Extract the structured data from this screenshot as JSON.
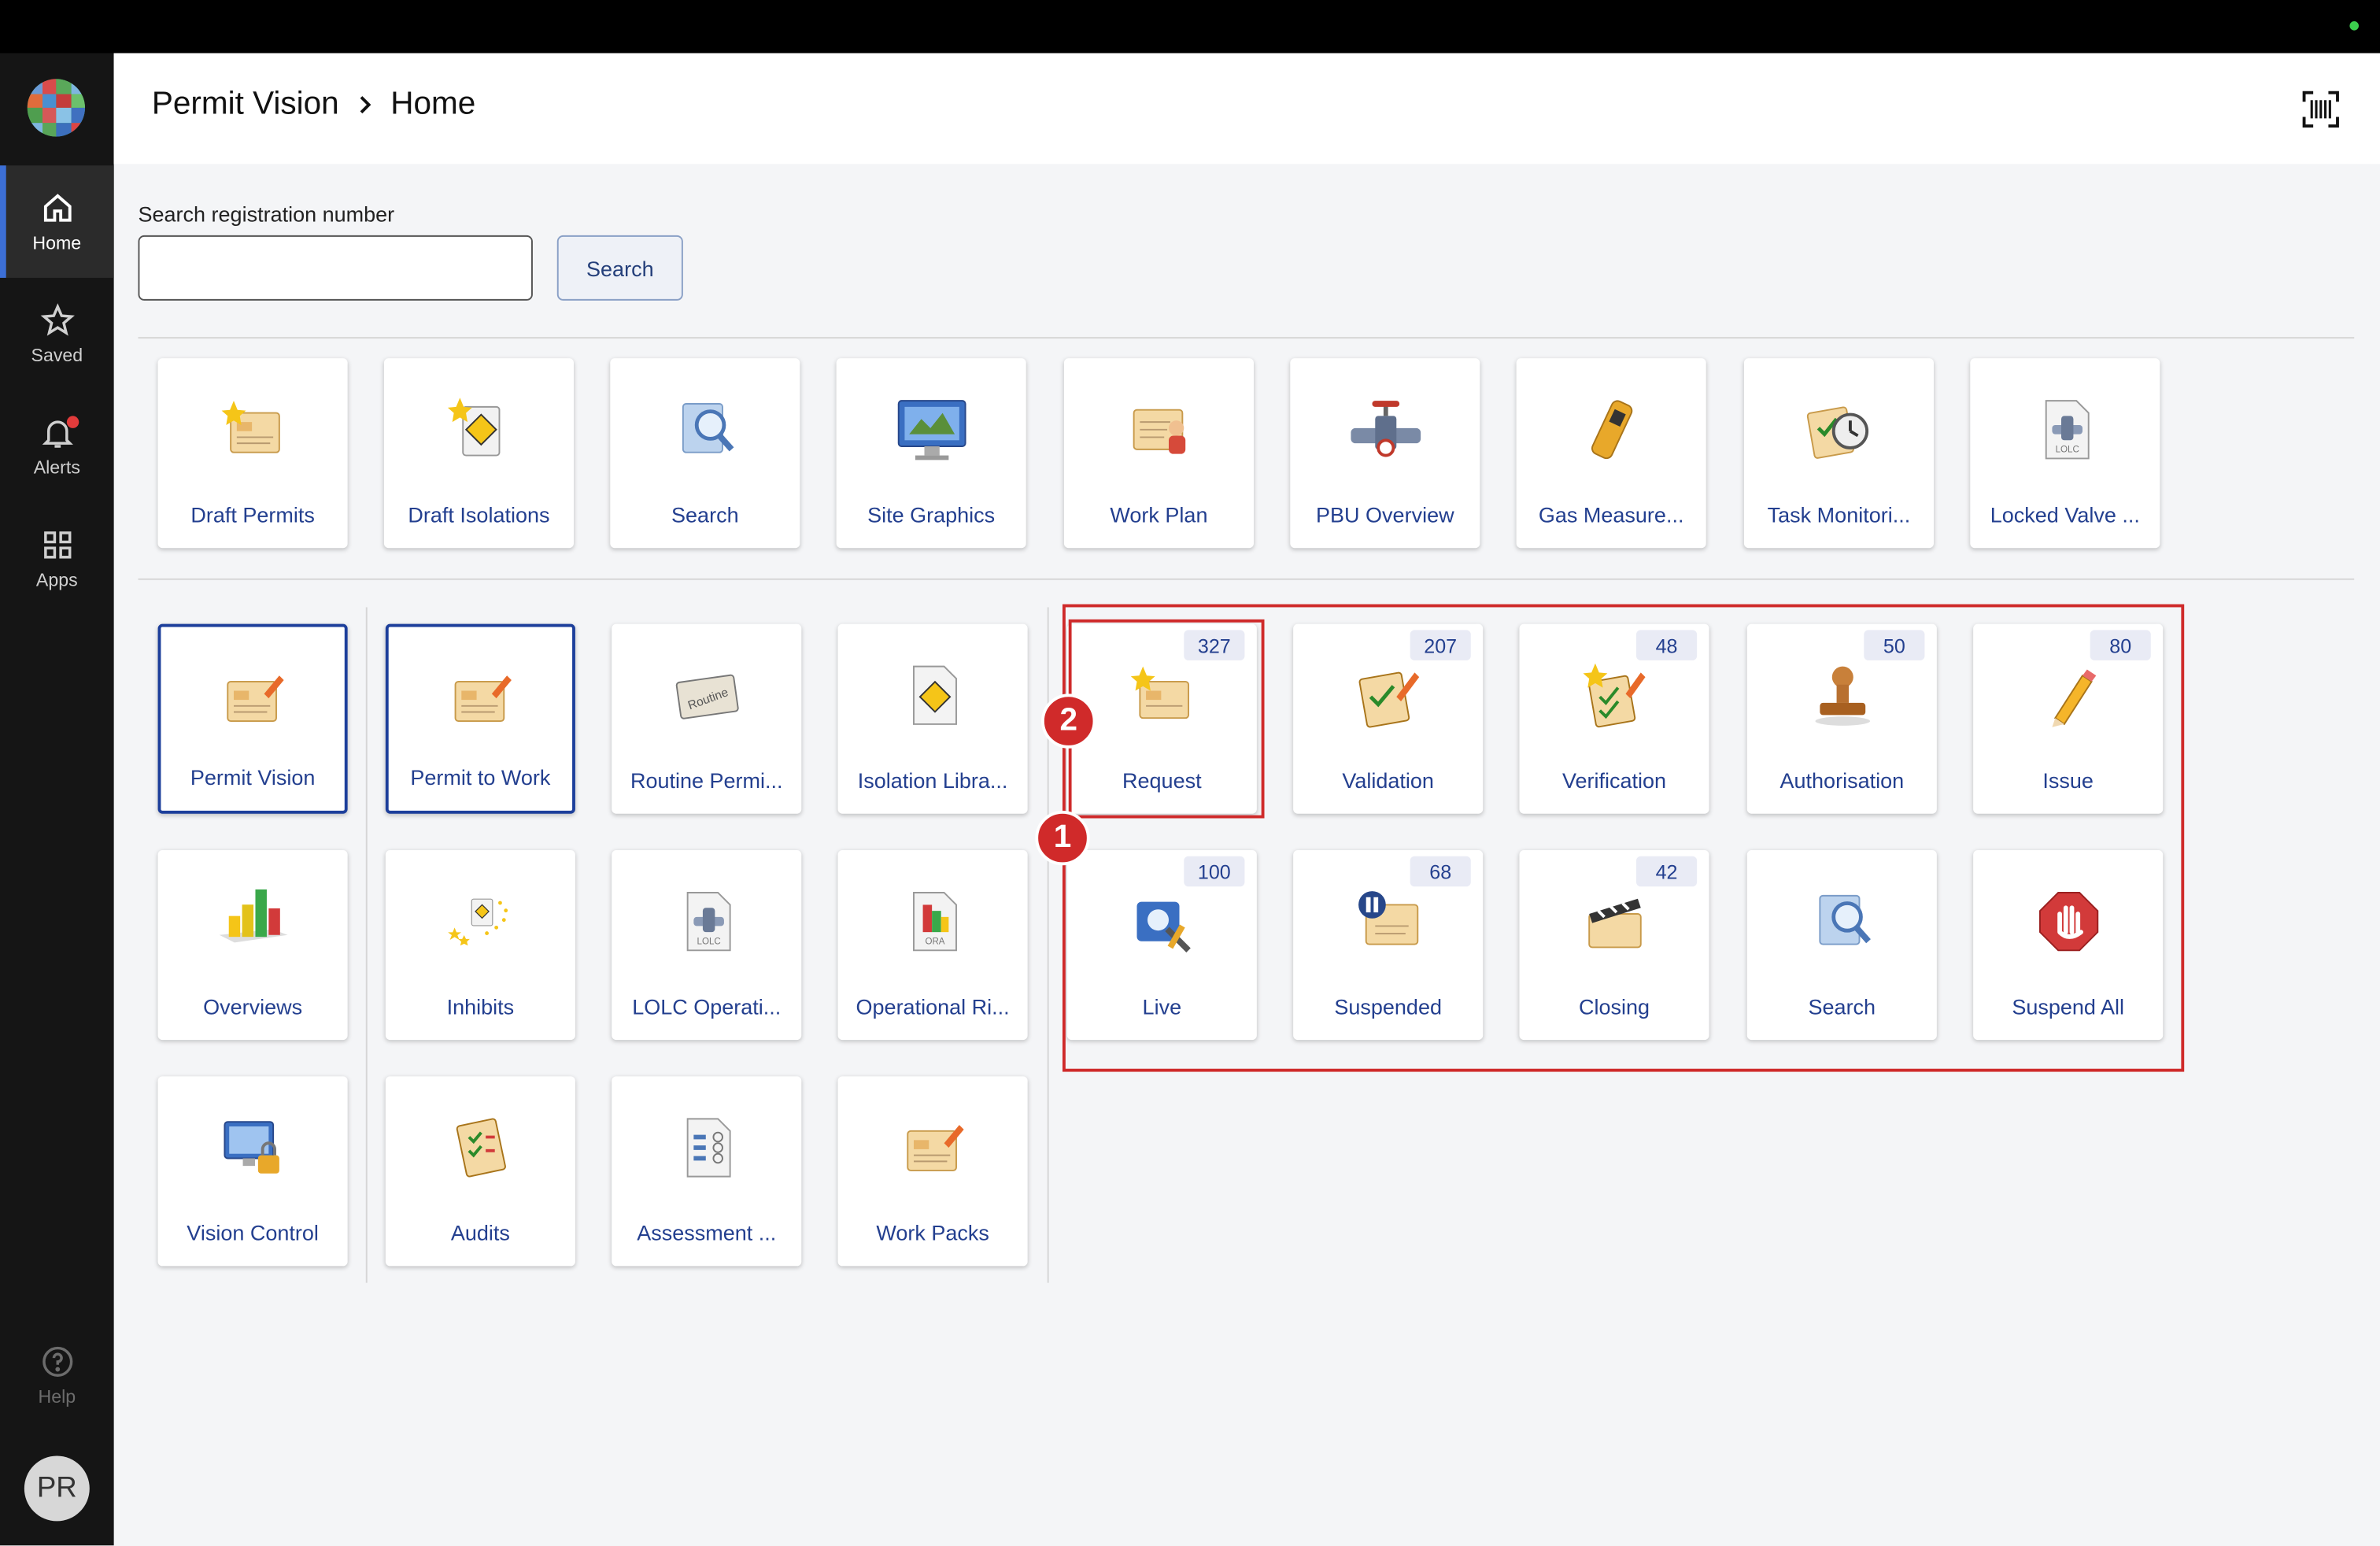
{
  "nav": {
    "home": "Home",
    "saved": "Saved",
    "alerts": "Alerts",
    "apps": "Apps",
    "help": "Help",
    "avatar_initials": "PR"
  },
  "header": {
    "breadcrumb": [
      "Permit Vision",
      "Home"
    ]
  },
  "search": {
    "label": "Search registration number",
    "value": "",
    "button": "Search"
  },
  "top_tiles": [
    {
      "label": "Draft Permits",
      "icon": "draft-permit-icon"
    },
    {
      "label": "Draft Isolations",
      "icon": "draft-isolation-icon"
    },
    {
      "label": "Search",
      "icon": "magnifier-icon"
    },
    {
      "label": "Site Graphics",
      "icon": "monitor-graphics-icon"
    },
    {
      "label": "Work Plan",
      "icon": "work-plan-icon"
    },
    {
      "label": "PBU Overview",
      "icon": "pipe-valve-icon"
    },
    {
      "label": "Gas Measure...",
      "icon": "gas-meter-icon"
    },
    {
      "label": "Task Monitori...",
      "icon": "task-stopwatch-icon"
    },
    {
      "label": "Locked Valve ...",
      "icon": "locked-valve-icon"
    }
  ],
  "left_tiles": [
    {
      "label": "Permit Vision",
      "icon": "permit-icon",
      "selected": true
    },
    {
      "label": "Permit to Work",
      "icon": "permit-icon",
      "selected": true
    },
    {
      "label": "Routine Permi...",
      "icon": "routine-icon",
      "selected": false
    },
    {
      "label": "Isolation Libra...",
      "icon": "isolation-library-icon",
      "selected": false
    },
    {
      "label": "Overviews",
      "icon": "bar-chart-icon",
      "selected": false
    },
    {
      "label": "Inhibits",
      "icon": "inhibit-stars-icon",
      "selected": false
    },
    {
      "label": "LOLC Operati...",
      "icon": "lolc-icon",
      "selected": false
    },
    {
      "label": "Operational Ri...",
      "icon": "ora-icon",
      "selected": false
    },
    {
      "label": "Vision Control",
      "icon": "monitor-lock-icon",
      "selected": false
    },
    {
      "label": "Audits",
      "icon": "audit-checklist-icon",
      "selected": false
    },
    {
      "label": "Assessment ...",
      "icon": "assessment-icon",
      "selected": false
    },
    {
      "label": "Work Packs",
      "icon": "work-pack-icon",
      "selected": false
    }
  ],
  "status_tiles": [
    {
      "label": "Request",
      "count": "327",
      "icon": "request-icon"
    },
    {
      "label": "Validation",
      "count": "207",
      "icon": "validation-icon"
    },
    {
      "label": "Verification",
      "count": "48",
      "icon": "verification-icon"
    },
    {
      "label": "Authorisation",
      "count": "50",
      "icon": "stamp-icon"
    },
    {
      "label": "Issue",
      "count": "80",
      "icon": "pencil-icon"
    },
    {
      "label": "Live",
      "count": "100",
      "icon": "live-tools-icon"
    },
    {
      "label": "Suspended",
      "count": "68",
      "icon": "pause-icon"
    },
    {
      "label": "Closing",
      "count": "42",
      "icon": "clapper-icon"
    },
    {
      "label": "Search",
      "count": "",
      "icon": "magnifier-icon"
    },
    {
      "label": "Suspend All",
      "count": "",
      "icon": "stop-hand-icon"
    }
  ],
  "annotations": {
    "marker_1": "1",
    "marker_2": "2"
  },
  "colors": {
    "accent": "#1d3f9b",
    "annotation_red": "#cf2a2a",
    "sidebar": "#151515"
  }
}
